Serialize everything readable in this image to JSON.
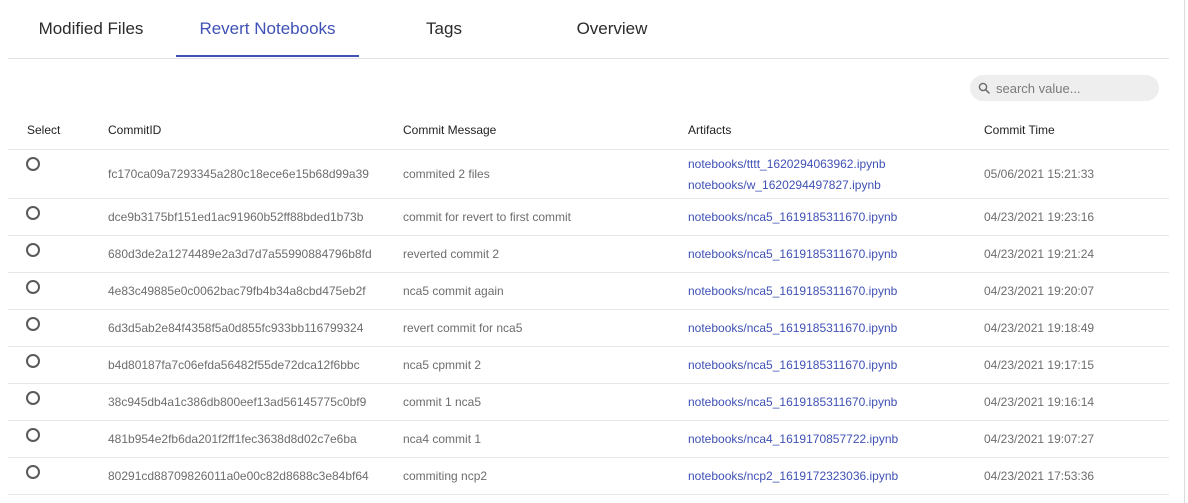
{
  "tabs": [
    {
      "label": "Modified Files",
      "active": false
    },
    {
      "label": "Revert Notebooks",
      "active": true
    },
    {
      "label": "Tags",
      "active": false
    },
    {
      "label": "Overview",
      "active": false
    }
  ],
  "search": {
    "placeholder": "search value...",
    "value": ""
  },
  "table": {
    "headers": {
      "select": "Select",
      "commit_id": "CommitID",
      "message": "Commit Message",
      "artifacts": "Artifacts",
      "time": "Commit Time"
    },
    "rows": [
      {
        "commit_id": "fc170ca09a7293345a280c18ece6e15b68d99a39",
        "message": "commited 2 files",
        "artifacts": [
          "notebooks/tttt_1620294063962.ipynb",
          "notebooks/w_1620294497827.ipynb"
        ],
        "time": "05/06/2021 15:21:33"
      },
      {
        "commit_id": "dce9b3175bf151ed1ac91960b52ff88bded1b73b",
        "message": "commit for revert to first commit",
        "artifacts": [
          "notebooks/nca5_1619185311670.ipynb"
        ],
        "time": "04/23/2021 19:23:16"
      },
      {
        "commit_id": "680d3de2a1274489e2a3d7d7a55990884796b8fd",
        "message": "reverted commit 2",
        "artifacts": [
          "notebooks/nca5_1619185311670.ipynb"
        ],
        "time": "04/23/2021 19:21:24"
      },
      {
        "commit_id": "4e83c49885e0c0062bac79fb4b34a8cbd475eb2f",
        "message": "nca5 commit again",
        "artifacts": [
          "notebooks/nca5_1619185311670.ipynb"
        ],
        "time": "04/23/2021 19:20:07"
      },
      {
        "commit_id": "6d3d5ab2e84f4358f5a0d855fc933bb116799324",
        "message": "revert commit for nca5",
        "artifacts": [
          "notebooks/nca5_1619185311670.ipynb"
        ],
        "time": "04/23/2021 19:18:49"
      },
      {
        "commit_id": "b4d80187fa7c06efda56482f55de72dca12f6bbc",
        "message": "nca5 cpmmit 2",
        "artifacts": [
          "notebooks/nca5_1619185311670.ipynb"
        ],
        "time": "04/23/2021 19:17:15"
      },
      {
        "commit_id": "38c945db4a1c386db800eef13ad56145775c0bf9",
        "message": "commit 1 nca5",
        "artifacts": [
          "notebooks/nca5_1619185311670.ipynb"
        ],
        "time": "04/23/2021 19:16:14"
      },
      {
        "commit_id": "481b954e2fb6da201f2ff1fec3638d8d02c7e6ba",
        "message": "nca4 commit 1",
        "artifacts": [
          "notebooks/nca4_1619170857722.ipynb"
        ],
        "time": "04/23/2021 19:07:27"
      },
      {
        "commit_id": "80291cd88709826011a0e00c82d8688c3e84bf64",
        "message": "commiting ncp2",
        "artifacts": [
          "notebooks/ncp2_1619172323036.ipynb"
        ],
        "time": "04/23/2021 17:53:36"
      }
    ]
  },
  "colors": {
    "accent": "#3f51b5",
    "text": "#6d6d6d",
    "search_bg": "#eeeeee"
  },
  "icons": {
    "search": "search-icon",
    "radio": "radio-unchecked-icon"
  }
}
